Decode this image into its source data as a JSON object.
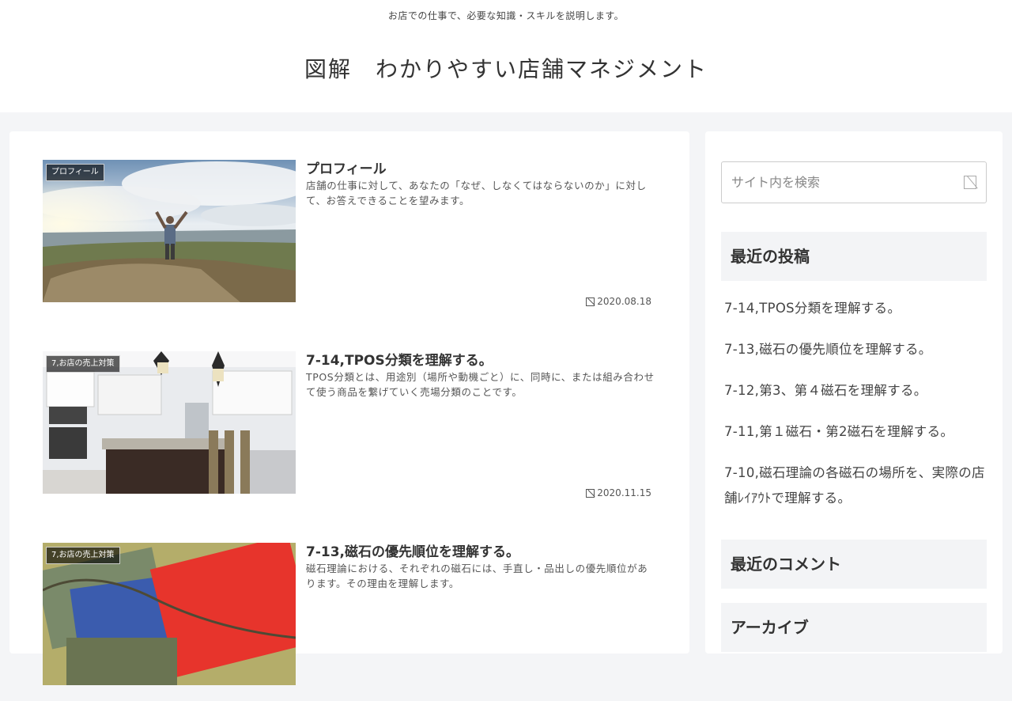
{
  "header": {
    "tagline": "お店での仕事で、必要な知識・スキルを説明します。",
    "site_title": "図解　わかりやすい店舗マネジメント"
  },
  "posts": [
    {
      "category": "プロフィール",
      "title": "プロフィール",
      "excerpt": "店舗の仕事に対して、あなたの「なぜ、しなくてはならないのか」に対して、お答えできることを望みます。",
      "date": "2020.08.18"
    },
    {
      "category": "7,お店の売上対策",
      "title": "7-14,TPOS分類を理解する。",
      "excerpt": "TPOS分類とは、用途別（場所や動機ごと）に、同時に、または組み合わせて使う商品を繋げていく売場分類のことです。",
      "date": "2020.11.15"
    },
    {
      "category": "7,お店の売上対策",
      "title": "7-13,磁石の優先順位を理解する。",
      "excerpt": "磁石理論における、それぞれの磁石には、手直し・品出しの優先順位があります。その理由を理解します。",
      "date": ""
    }
  ],
  "sidebar": {
    "search_placeholder": "サイト内を検索",
    "recent_posts_title": "最近の投稿",
    "recent_posts": [
      "7-14,TPOS分類を理解する。",
      "7-13,磁石の優先順位を理解する。",
      "7-12,第3、第４磁石を理解する。",
      "7-11,第１磁石・第2磁石を理解する。",
      "7-10,磁石理論の各磁石の場所を、実際の店舗ﾚｲｱｳﾄで理解する。"
    ],
    "recent_comments_title": "最近のコメント",
    "archive_title": "アーカイブ"
  }
}
